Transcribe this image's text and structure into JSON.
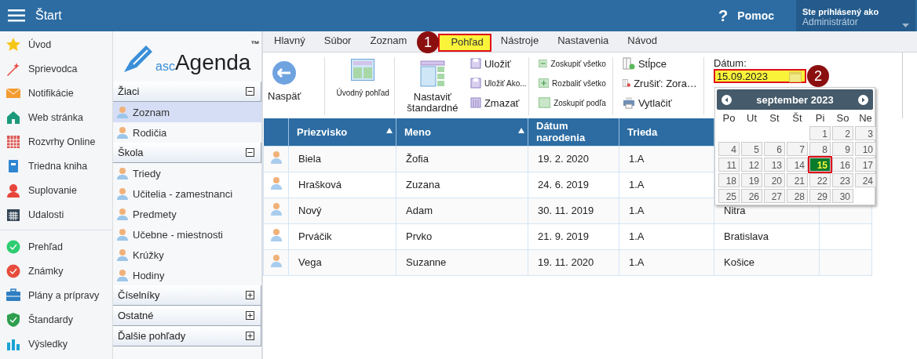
{
  "top_bar": {
    "title": "Štart",
    "help_mark": "?",
    "help": "Pomoc",
    "user_label": "Ste prihlásený ako",
    "user": "Administrátor"
  },
  "nav": {
    "groups": [
      [
        {
          "label": "Úvod"
        },
        {
          "label": "Sprievodca"
        },
        {
          "label": "Notifikácie"
        },
        {
          "label": "Web stránka"
        },
        {
          "label": "Rozvrhy Online"
        },
        {
          "label": "Triedna kniha"
        },
        {
          "label": "Suplovanie"
        },
        {
          "label": "Udalosti"
        }
      ],
      [
        {
          "label": "Prehľad"
        },
        {
          "label": "Známky"
        },
        {
          "label": "Plány a prípravy"
        },
        {
          "label": "Štandardy"
        },
        {
          "label": "Výsledky"
        }
      ]
    ]
  },
  "side_panel": {
    "logo": {
      "prefix": "asc",
      "name": "Agenda",
      "mark": "™"
    },
    "sections": [
      {
        "title": "Žiaci",
        "expanded": true,
        "items": [
          {
            "label": "Zoznam",
            "selected": true
          },
          {
            "label": "Rodičia",
            "selected": false
          }
        ]
      },
      {
        "title": "Škola",
        "expanded": true,
        "items": [
          {
            "label": "Triedy",
            "selected": false
          },
          {
            "label": "Učitelia - zamestnanci",
            "selected": false
          },
          {
            "label": "Predmety",
            "selected": false
          },
          {
            "label": "Učebne - miestnosti",
            "selected": false
          },
          {
            "label": "Krúžky",
            "selected": false
          },
          {
            "label": "Hodiny",
            "selected": false
          }
        ]
      },
      {
        "title": "Číselníky",
        "expanded": false
      },
      {
        "title": "Ostatné",
        "expanded": false
      },
      {
        "title": "Ďalšie pohľady",
        "expanded": false
      }
    ]
  },
  "ribbon": {
    "tabs": [
      {
        "label": "Hlavný",
        "selected": false
      },
      {
        "label": "Súbor",
        "selected": false
      },
      {
        "label": "Zoznam",
        "selected": false
      },
      {
        "label": "Pohľad",
        "selected": true
      },
      {
        "label": "Nástroje",
        "selected": false
      },
      {
        "label": "Nastavenia",
        "selected": false
      },
      {
        "label": "Návod",
        "selected": false
      }
    ],
    "back": "Naspäť",
    "home_view": "Úvodný pohľad",
    "set_default": "Nastaviť štandardné",
    "save_items": [
      "Uložiť",
      "Uložiť Ako...",
      "Zmazať"
    ],
    "group_items": [
      "Zoskupiť všetko",
      "Rozbaliť všetko",
      "Zoskupiť podľa"
    ],
    "column_items": [
      "Stĺpce",
      "Zrušiť: Zora…",
      "Vytlačiť"
    ],
    "date_label": "Dátum:",
    "date_value": "15.09.2023"
  },
  "annotations": [
    "1",
    "2"
  ],
  "table": {
    "columns": [
      {
        "label": "Priezvisko",
        "sorted": true
      },
      {
        "label": "Meno",
        "sorted": true
      },
      {
        "label": "Dátum narodenia",
        "sorted": false
      },
      {
        "label": "Trieda",
        "sorted": false
      }
    ],
    "rows": [
      {
        "cells": [
          "Biela",
          "Žofia",
          "19. 2. 2020",
          "1.A"
        ]
      },
      {
        "cells": [
          "Hrašková",
          "Zuzana",
          "24. 6. 2019",
          "1.A"
        ]
      },
      {
        "cells": [
          "Nový",
          "Adam",
          "30. 11. 2019",
          "1.A",
          "Nitra"
        ]
      },
      {
        "cells": [
          "Prváčik",
          "Prvko",
          "21. 9. 2019",
          "1.A",
          "Bratislava"
        ]
      },
      {
        "cells": [
          "Vega",
          "Suzanne",
          "19. 11. 2020",
          "1.A",
          "Košice"
        ]
      }
    ]
  },
  "calendar": {
    "title": "september 2023",
    "weekdays": [
      "Po",
      "Ut",
      "St",
      "Št",
      "Pi",
      "So",
      "Ne"
    ],
    "weeks": [
      [
        {
          "label": "1",
          "selected": false
        },
        {
          "label": "2",
          "selected": false
        },
        {
          "label": "3",
          "selected": false
        }
      ],
      [
        {
          "label": "4",
          "selected": false
        },
        {
          "label": "5",
          "selected": false
        },
        {
          "label": "6",
          "selected": false
        },
        {
          "label": "7",
          "selected": false
        },
        {
          "label": "8",
          "selected": false
        },
        {
          "label": "9",
          "selected": false
        },
        {
          "label": "10",
          "selected": false
        }
      ],
      [
        {
          "label": "11",
          "selected": false
        },
        {
          "label": "12",
          "selected": false
        },
        {
          "label": "13",
          "selected": false
        },
        {
          "label": "14",
          "selected": false
        },
        {
          "label": "15",
          "selected": true
        },
        {
          "label": "16",
          "selected": false
        },
        {
          "label": "17",
          "selected": false
        }
      ],
      [
        {
          "label": "18",
          "selected": false
        },
        {
          "label": "19",
          "selected": false
        },
        {
          "label": "20",
          "selected": false
        },
        {
          "label": "21",
          "selected": false
        },
        {
          "label": "22",
          "selected": false
        },
        {
          "label": "23",
          "selected": false
        },
        {
          "label": "24",
          "selected": false
        }
      ],
      [
        {
          "label": "25",
          "selected": false
        },
        {
          "label": "26",
          "selected": false
        },
        {
          "label": "27",
          "selected": false
        },
        {
          "label": "28",
          "selected": false
        },
        {
          "label": "29",
          "selected": false
        },
        {
          "label": "30",
          "selected": false
        }
      ]
    ]
  }
}
